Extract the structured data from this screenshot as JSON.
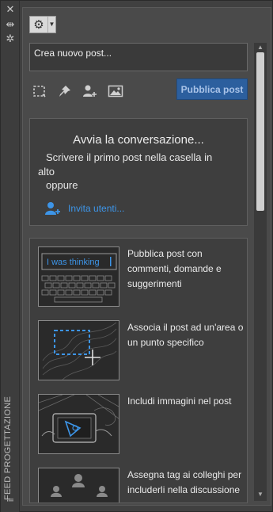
{
  "strip": {
    "title": "FEED PROGETTAZIONE",
    "icons": [
      "close-icon",
      "pin-icon",
      "settings-icon",
      "menu-icon"
    ]
  },
  "toolbar": {
    "settings_icon": "gear-icon"
  },
  "compose": {
    "placeholder": "Crea nuovo post..."
  },
  "tools": [
    "select-area-icon",
    "pushpin-icon",
    "add-user-icon",
    "image-icon"
  ],
  "publish": {
    "label": "Pubblica post"
  },
  "start": {
    "title": "Avvia la conversazione...",
    "text": "Scrivere il primo post nella casella in alto",
    "or": "oppure",
    "invite": "Invita utenti..."
  },
  "tips": [
    {
      "text": "Pubblica post con commenti, domande e suggerimenti",
      "caption": "I was thinking"
    },
    {
      "text": "Associa il post ad un'area o un punto specifico"
    },
    {
      "text": "Includi immagini nel post"
    },
    {
      "text": "Assegna tag ai colleghi per includerli nella discussione"
    }
  ],
  "colors": {
    "accent": "#2c5f9e",
    "link": "#3d95e8",
    "background": "#4a4a4a"
  }
}
